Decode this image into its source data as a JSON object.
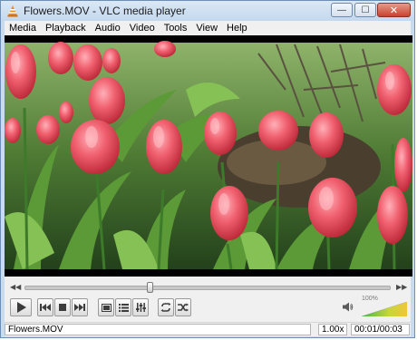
{
  "window": {
    "title": "Flowers.MOV - VLC media player",
    "minimize_label": "—",
    "maximize_label": "☐",
    "close_label": "✕"
  },
  "menu": [
    "Media",
    "Playback",
    "Audio",
    "Video",
    "Tools",
    "View",
    "Help"
  ],
  "playback": {
    "position": 0.34
  },
  "volume": {
    "percent_label": "100%",
    "level": 1.0
  },
  "status": {
    "filename": "Flowers.MOV",
    "speed": "1.00x",
    "time": "00:01/00:03"
  },
  "colors": {
    "tulip": "#e2495a",
    "tulip_light": "#f2798a",
    "leaf": "#3f7a2a",
    "leaf_light": "#7fb24b",
    "soil": "#3b3326"
  }
}
